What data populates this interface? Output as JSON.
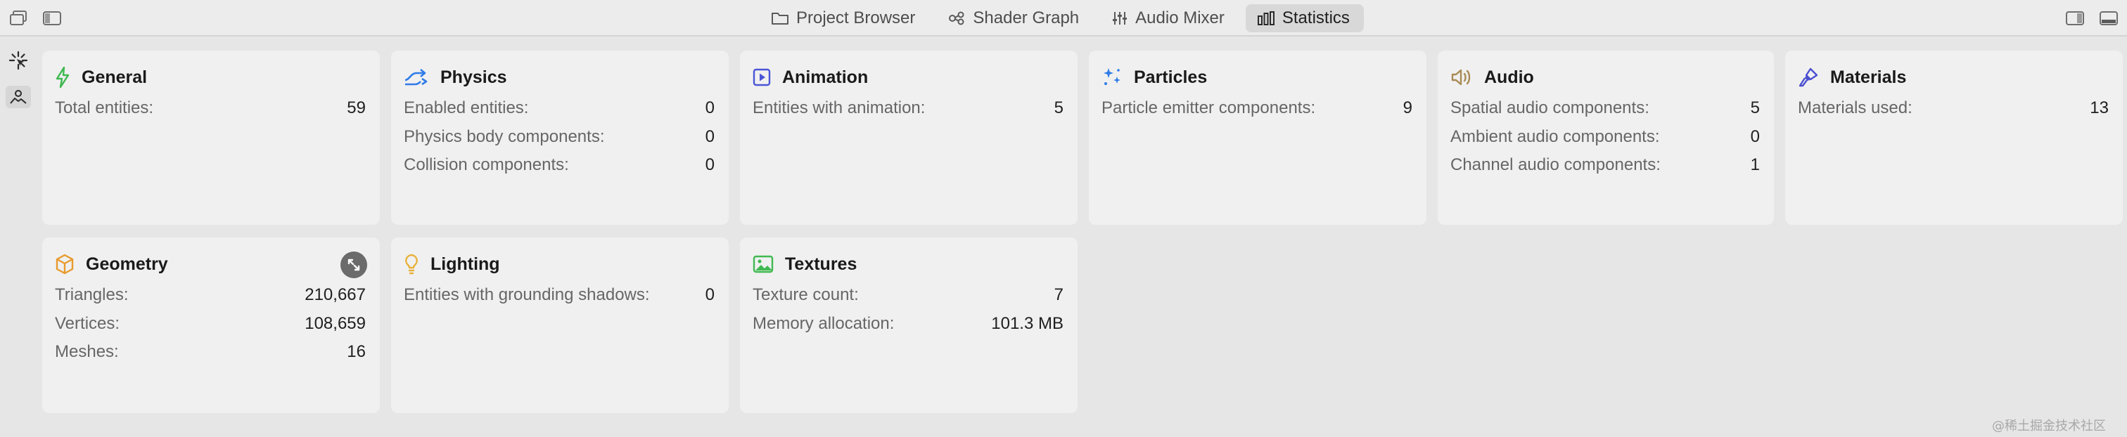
{
  "toolbar": {
    "tabs": [
      {
        "label": "Project Browser",
        "icon": "folder-icon"
      },
      {
        "label": "Shader Graph",
        "icon": "node-graph-icon"
      },
      {
        "label": "Audio Mixer",
        "icon": "sliders-icon"
      },
      {
        "label": "Statistics",
        "icon": "bar-chart-icon",
        "active": true
      }
    ]
  },
  "sidebar": {
    "items": [
      {
        "icon": "cursor-sparkle-icon"
      },
      {
        "icon": "scene-icon",
        "selected": true
      }
    ]
  },
  "cards": {
    "general": {
      "title": "General",
      "icon": "bolt-icon",
      "icon_color": "#3fb950",
      "rows": [
        {
          "label": "Total entities:",
          "value": "59"
        }
      ]
    },
    "physics": {
      "title": "Physics",
      "icon": "physics-arrows-icon",
      "icon_color": "#2f7be8",
      "rows": [
        {
          "label": "Enabled entities:",
          "value": "0"
        },
        {
          "label": "Physics body components:",
          "value": "0"
        },
        {
          "label": "Collision components:",
          "value": "0"
        }
      ]
    },
    "animation": {
      "title": "Animation",
      "icon": "play-square-icon",
      "icon_color": "#4a55d6",
      "rows": [
        {
          "label": "Entities with animation:",
          "value": "5"
        }
      ]
    },
    "particles": {
      "title": "Particles",
      "icon": "sparkles-icon",
      "icon_color": "#2f7be8",
      "rows": [
        {
          "label": "Particle emitter components:",
          "value": "9"
        }
      ]
    },
    "audio": {
      "title": "Audio",
      "icon": "speaker-icon",
      "icon_color": "#a88a55",
      "rows": [
        {
          "label": "Spatial audio components:",
          "value": "5"
        },
        {
          "label": "Ambient audio components:",
          "value": "0"
        },
        {
          "label": "Channel audio components:",
          "value": "1"
        }
      ]
    },
    "materials": {
      "title": "Materials",
      "icon": "paintbrush-icon",
      "icon_color": "#4a4fd0",
      "rows": [
        {
          "label": "Materials used:",
          "value": "13"
        }
      ]
    },
    "geometry": {
      "title": "Geometry",
      "icon": "cube-icon",
      "icon_color": "#e89a2c",
      "rows": [
        {
          "label": "Triangles:",
          "value": "210,667"
        },
        {
          "label": "Vertices:",
          "value": "108,659"
        },
        {
          "label": "Meshes:",
          "value": "16"
        }
      ]
    },
    "lighting": {
      "title": "Lighting",
      "icon": "lightbulb-icon",
      "icon_color": "#e8b13a",
      "rows": [
        {
          "label": "Entities with grounding shadows:",
          "value": "0"
        }
      ]
    },
    "textures": {
      "title": "Textures",
      "icon": "photo-icon",
      "icon_color": "#3fb950",
      "rows": [
        {
          "label": "Texture count:",
          "value": "7"
        },
        {
          "label": "Memory allocation:",
          "value": "101.3 MB"
        }
      ]
    }
  },
  "watermark": "@稀土掘金技术社区"
}
